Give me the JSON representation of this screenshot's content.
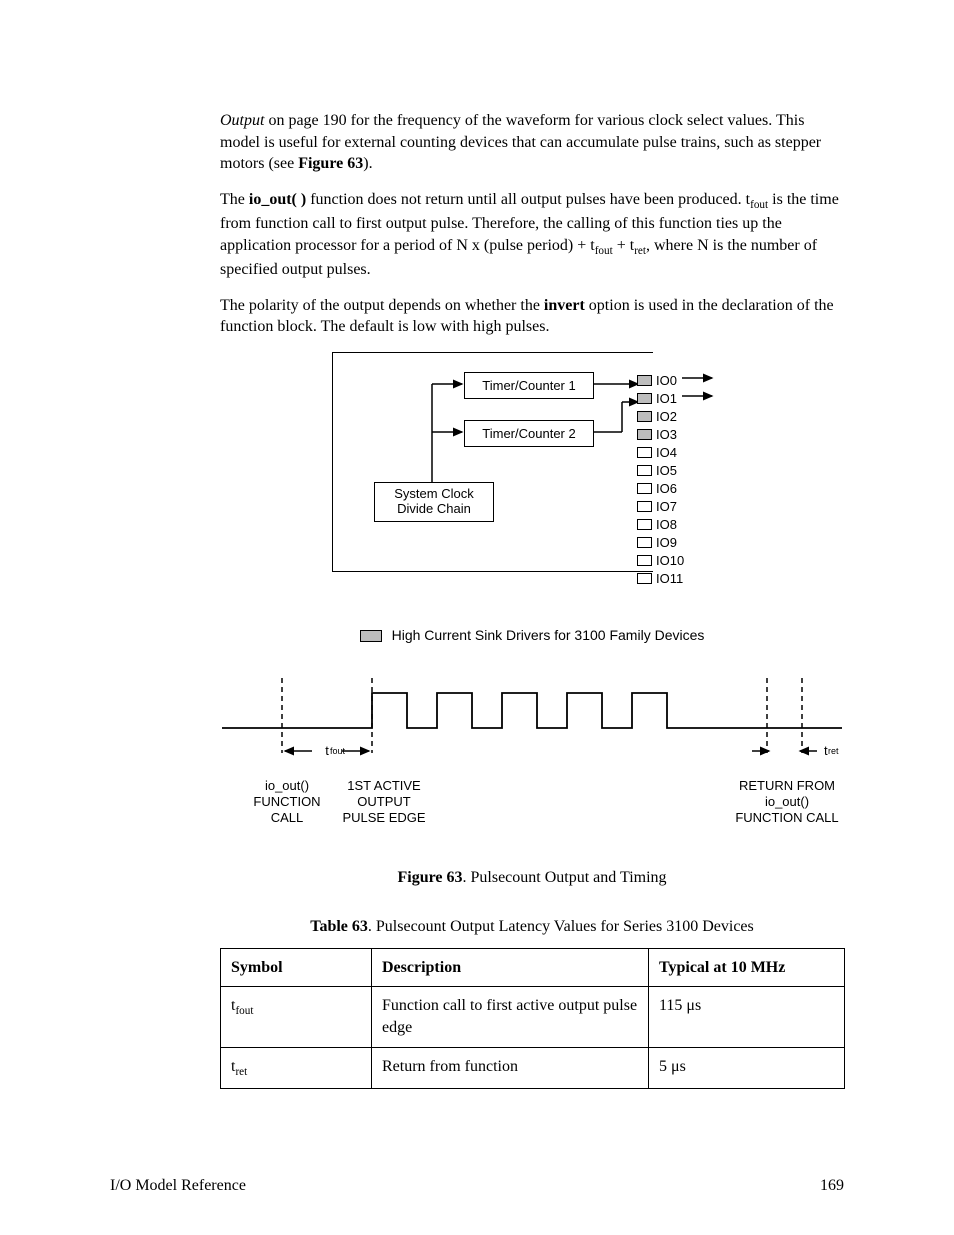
{
  "paragraphs": {
    "p1a": "Output",
    "p1b": " on page 190 for the frequency of the waveform for various clock select values.  This model is useful for external counting devices that can accumulate pulse trains, such as stepper motors (see ",
    "p1c": "Figure 63",
    "p1d": ").",
    "p2a": "The ",
    "p2b": "io_out( )",
    "p2c": " function does not return until all output pulses have been produced.  t",
    "p2d": "fout",
    "p2e": " is the time from function call to first output pulse.  Therefore, the calling of this function ties up the application processor for a period of N x (pulse period) + t",
    "p2f": "fout",
    "p2g": " + t",
    "p2h": "ret",
    "p2i": ", where N is the number of specified output pulses.",
    "p3a": "The polarity of the output depends on whether the ",
    "p3b": "invert",
    "p3c": " option is used in the declaration of the function block.  The default is low with high pulses."
  },
  "block_diagram": {
    "tc1": "Timer/Counter 1",
    "tc2": "Timer/Counter 2",
    "sys1": "System Clock",
    "sys2": "Divide Chain",
    "pins": [
      "IO0",
      "IO1",
      "IO2",
      "IO3",
      "IO4",
      "IO5",
      "IO6",
      "IO7",
      "IO8",
      "IO9",
      "IO10",
      "IO11"
    ],
    "legend": "High Current Sink Drivers for 3100 Family Devices"
  },
  "timing": {
    "tfout": "fout",
    "tret": "ret",
    "label_call_1": "io_out()",
    "label_call_2": "FUNCTION",
    "label_call_3": "CALL",
    "label_edge_1": "1ST ACTIVE",
    "label_edge_2": "OUTPUT",
    "label_edge_3": "PULSE EDGE",
    "label_ret_1": "RETURN FROM",
    "label_ret_2": "io_out()",
    "label_ret_3": "FUNCTION CALL"
  },
  "figure_caption_bold": "Figure 63",
  "figure_caption_rest": ". Pulsecount Output and Timing",
  "table_caption_bold": "Table 63",
  "table_caption_rest": ". Pulsecount Output Latency Values for Series 3100 Devices",
  "table": {
    "h1": "Symbol",
    "h2": "Description",
    "h3": "Typical at 10 MHz",
    "r1_sym_t": "t",
    "r1_sym_sub": "fout",
    "r1_desc": "Function call to first active output pulse edge",
    "r1_val": "115 μs",
    "r2_sym_t": "t",
    "r2_sym_sub": "ret",
    "r2_desc": "Return from function",
    "r2_val": "5 μs"
  },
  "footer": {
    "left": "I/O Model Reference",
    "right": "169"
  },
  "chart_data": {
    "type": "table",
    "title": "Pulsecount Output Latency Values for Series 3100 Devices",
    "columns": [
      "Symbol",
      "Description",
      "Typical at 10 MHz"
    ],
    "rows": [
      [
        "t_fout",
        "Function call to first active output pulse edge",
        "115 μs"
      ],
      [
        "t_ret",
        "Return from function",
        "5 μs"
      ]
    ]
  }
}
